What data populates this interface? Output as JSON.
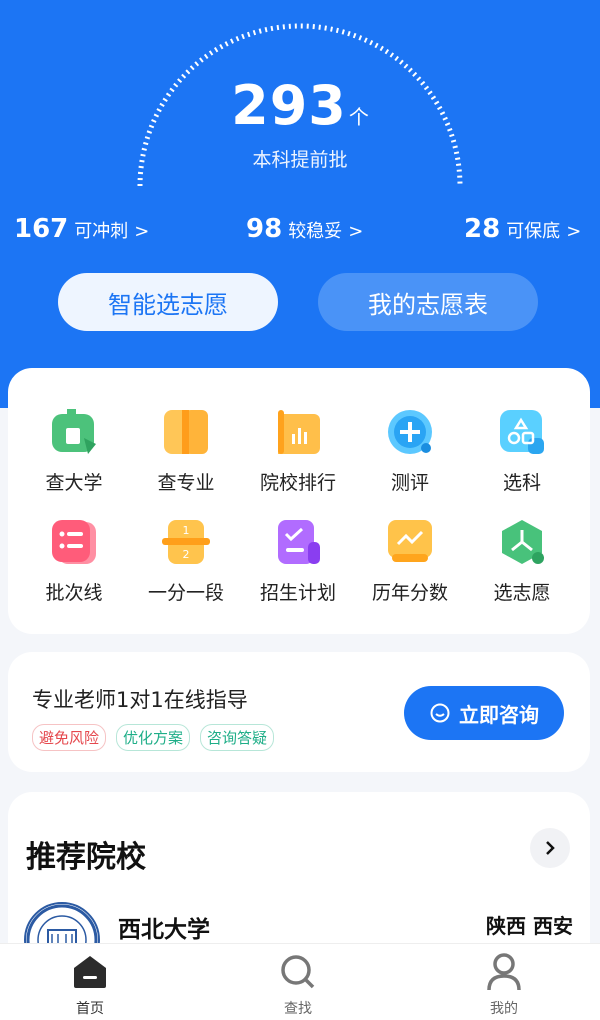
{
  "summary": {
    "total": "293",
    "unit": "个",
    "caption": "本科提前批"
  },
  "stats": [
    {
      "num": "167",
      "label": "可冲刺",
      "chevron": ">"
    },
    {
      "num": "98",
      "label": "较稳妥",
      "chevron": ">"
    },
    {
      "num": "28",
      "label": "可保底",
      "chevron": ">"
    }
  ],
  "actions": {
    "smart_select": "智能选志愿",
    "my_table": "我的志愿表"
  },
  "grid": [
    {
      "label": "查大学",
      "icon": "university-icon"
    },
    {
      "label": "查专业",
      "icon": "book-icon"
    },
    {
      "label": "院校排行",
      "icon": "ranking-icon"
    },
    {
      "label": "测评",
      "icon": "assessment-icon"
    },
    {
      "label": "选科",
      "icon": "subject-select-icon"
    },
    {
      "label": "批次线",
      "icon": "batch-line-icon"
    },
    {
      "label": "一分一段",
      "icon": "score-segment-icon"
    },
    {
      "label": "招生计划",
      "icon": "enrollment-plan-icon"
    },
    {
      "label": "历年分数",
      "icon": "history-score-icon"
    },
    {
      "label": "选志愿",
      "icon": "choose-application-icon"
    }
  ],
  "consult": {
    "title": "专业老师1对1在线指导",
    "tags": [
      "避免风险",
      "优化方案",
      "咨询答疑"
    ],
    "button": "立即咨询"
  },
  "recommend": {
    "title": "推荐院校",
    "school": {
      "name": "西北大学",
      "location": "陕西 西安"
    }
  },
  "nav": [
    {
      "label": "首页",
      "icon": "home-icon"
    },
    {
      "label": "查找",
      "icon": "search-icon"
    },
    {
      "label": "我的",
      "icon": "profile-icon"
    }
  ],
  "colors": {
    "brand": "#1c75f4",
    "background": "#f4f6fa"
  }
}
